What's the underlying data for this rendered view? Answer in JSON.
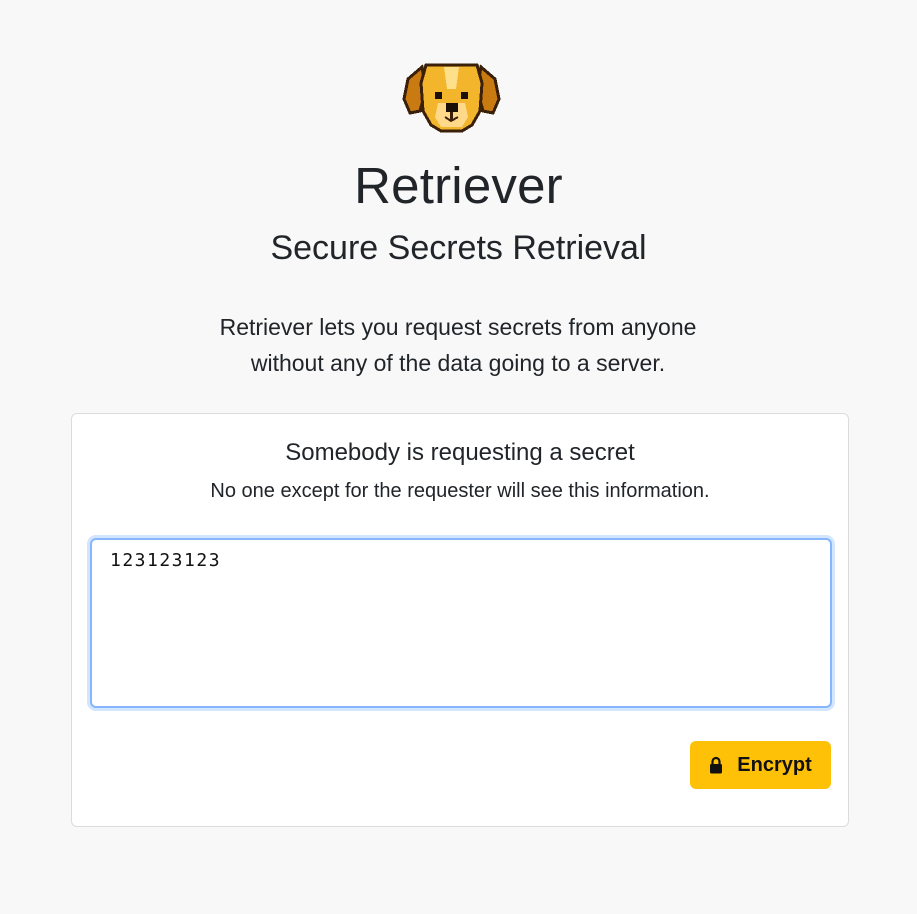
{
  "header": {
    "logo_icon": "golden-retriever-pixel-icon",
    "title": "Retriever",
    "subtitle": "Secure Secrets Retrieval",
    "lead_line1": "Retriever lets you request secrets from anyone",
    "lead_line2": "without any of the data going to a server."
  },
  "card": {
    "title": "Somebody is requesting a secret",
    "subtitle": "No one except for the requester will see this information.",
    "secret_value": "123123123",
    "encrypt_label": "Encrypt",
    "encrypt_icon": "lock-icon"
  },
  "colors": {
    "background": "#f8f8f8",
    "accent": "#ffc107",
    "focus_border": "#86b7fe",
    "text": "#212529"
  }
}
